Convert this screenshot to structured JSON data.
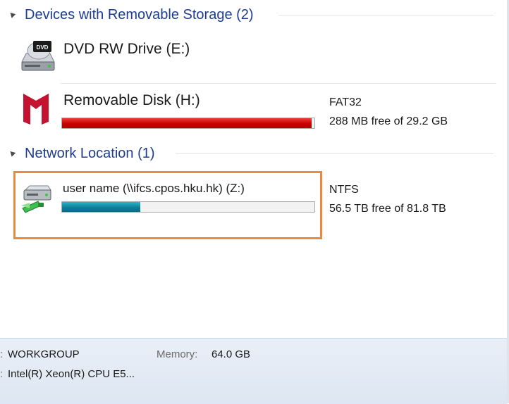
{
  "groups": [
    {
      "title": "Devices with Removable Storage (2)",
      "icon": "expand-triangle-icon"
    },
    {
      "title": "Network Location (1)",
      "icon": "expand-triangle-icon"
    }
  ],
  "devices": [
    {
      "label": "DVD RW Drive (E:)",
      "icon": "dvd-drive-icon",
      "icon_text": "DVD"
    },
    {
      "label": "Removable Disk (H:)",
      "icon": "mcafee-removable-disk-icon",
      "filesystem": "FAT32",
      "free_text": "288 MB free of 29.2 GB",
      "used_fraction": 0.99,
      "bar_color": "#c80000"
    }
  ],
  "network": [
    {
      "label": "user name (\\\\ifcs.cpos.hku.hk) (Z:)",
      "icon": "network-drive-icon",
      "filesystem": "NTFS",
      "free_text": "56.5 TB free of 81.8 TB",
      "used_fraction": 0.31,
      "bar_color": "#0f7f9a"
    }
  ],
  "details": {
    "workgroup_value": "WORKGROUP",
    "processor_value": "Intel(R) Xeon(R) CPU E5...",
    "memory_label": "Memory:",
    "memory_value": "64.0 GB"
  },
  "colors": {
    "highlight": "#ea8a3c",
    "group_title": "#1e3d8f"
  }
}
